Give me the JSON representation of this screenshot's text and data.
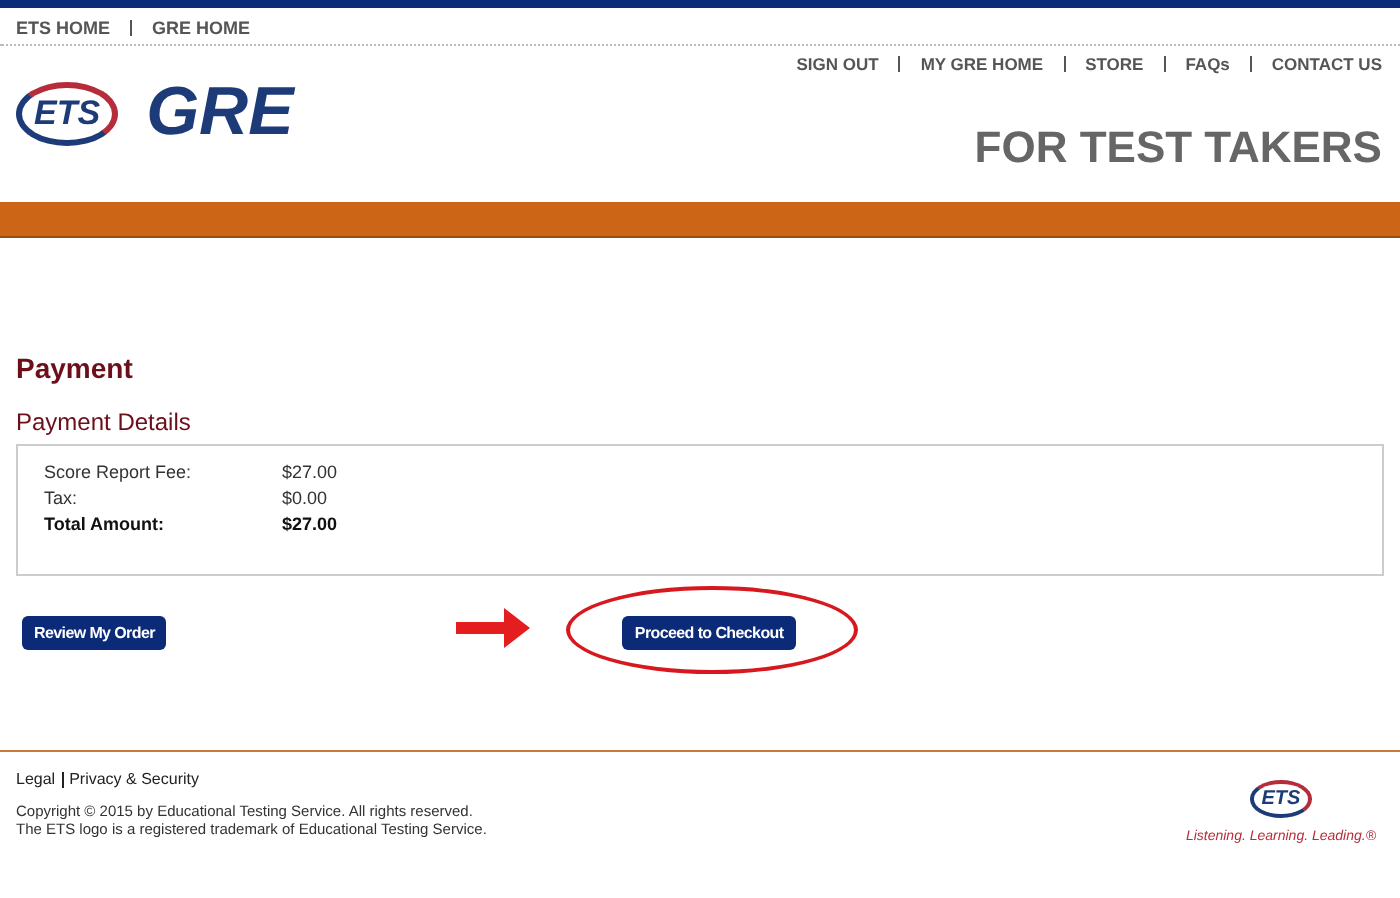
{
  "top_links": [
    "ETS HOME",
    "GRE HOME"
  ],
  "logo": {
    "ets": "ETS",
    "gre": "GRE"
  },
  "nav": [
    "SIGN OUT",
    "MY GRE HOME",
    "STORE",
    "FAQs",
    "CONTACT US"
  ],
  "banner": "FOR TEST TAKERS",
  "page_title": "Payment",
  "section_title": "Payment Details",
  "rows": [
    {
      "label": "Score Report Fee:",
      "value": "$27.00",
      "kind": "normal"
    },
    {
      "label": "Tax:",
      "value": "$0.00",
      "kind": "normal"
    },
    {
      "label": "Total Amount:",
      "value": "$27.00",
      "kind": "total"
    }
  ],
  "buttons": [
    {
      "label": "Review My Order",
      "highlighted": false
    },
    {
      "label": "Proceed to Checkout",
      "highlighted": true
    }
  ],
  "footer": {
    "links": [
      "Legal",
      "Privacy & Security"
    ],
    "copyright": "Copyright © 2015 by Educational Testing Service. All rights reserved.",
    "trademark": "The ETS logo is a registered trademark of Educational Testing Service.",
    "logo": "ETS",
    "tagline": "Listening. Learning. Leading.®"
  }
}
